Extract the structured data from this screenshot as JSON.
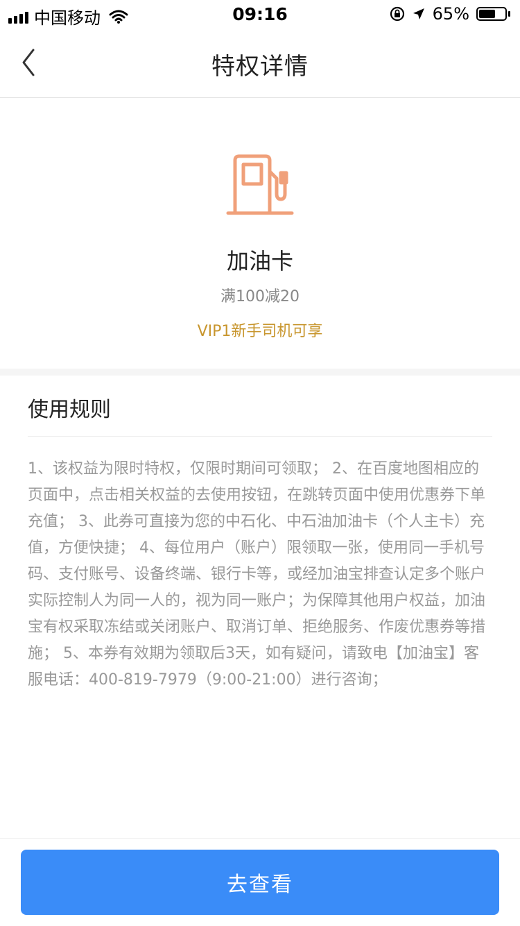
{
  "status_bar": {
    "carrier": "中国移动",
    "time": "09:16",
    "battery_percent": "65%",
    "battery_level": 0.65,
    "icons": [
      "signal-icon",
      "wifi-icon",
      "orientation-lock-icon",
      "location-arrow-icon",
      "battery-icon"
    ]
  },
  "nav": {
    "title": "特权详情",
    "back_icon": "chevron-left-icon"
  },
  "card": {
    "icon": "gas-pump-icon",
    "icon_color": "#f0a07a",
    "title": "加油卡",
    "description": "满100减20",
    "eligibility": "VIP1新手司机可享",
    "eligibility_color": "#c8962e"
  },
  "rules": {
    "title": "使用规则",
    "text": "1、该权益为限时特权，仅限时期间可领取； 2、在百度地图相应的页面中，点击相关权益的去使用按钮，在跳转页面中使用优惠券下单充值； 3、此券可直接为您的中石化、中石油加油卡（个人主卡）充值，方便快捷； 4、每位用户（账户）限领取一张，使用同一手机号码、支付账号、设备终端、银行卡等，或经加油宝排查认定多个账户实际控制人为同一人的，视为同一账户；为保障其他用户权益，加油宝有权采取冻结或关闭账户、取消订单、拒绝服务、作废优惠券等措施； 5、本券有效期为领取后3天，如有疑问，请致电【加油宝】客服电话：400-819-7979（9:00-21:00）进行咨询；"
  },
  "footer": {
    "button_label": "去查看",
    "button_color": "#3a8cf8"
  }
}
